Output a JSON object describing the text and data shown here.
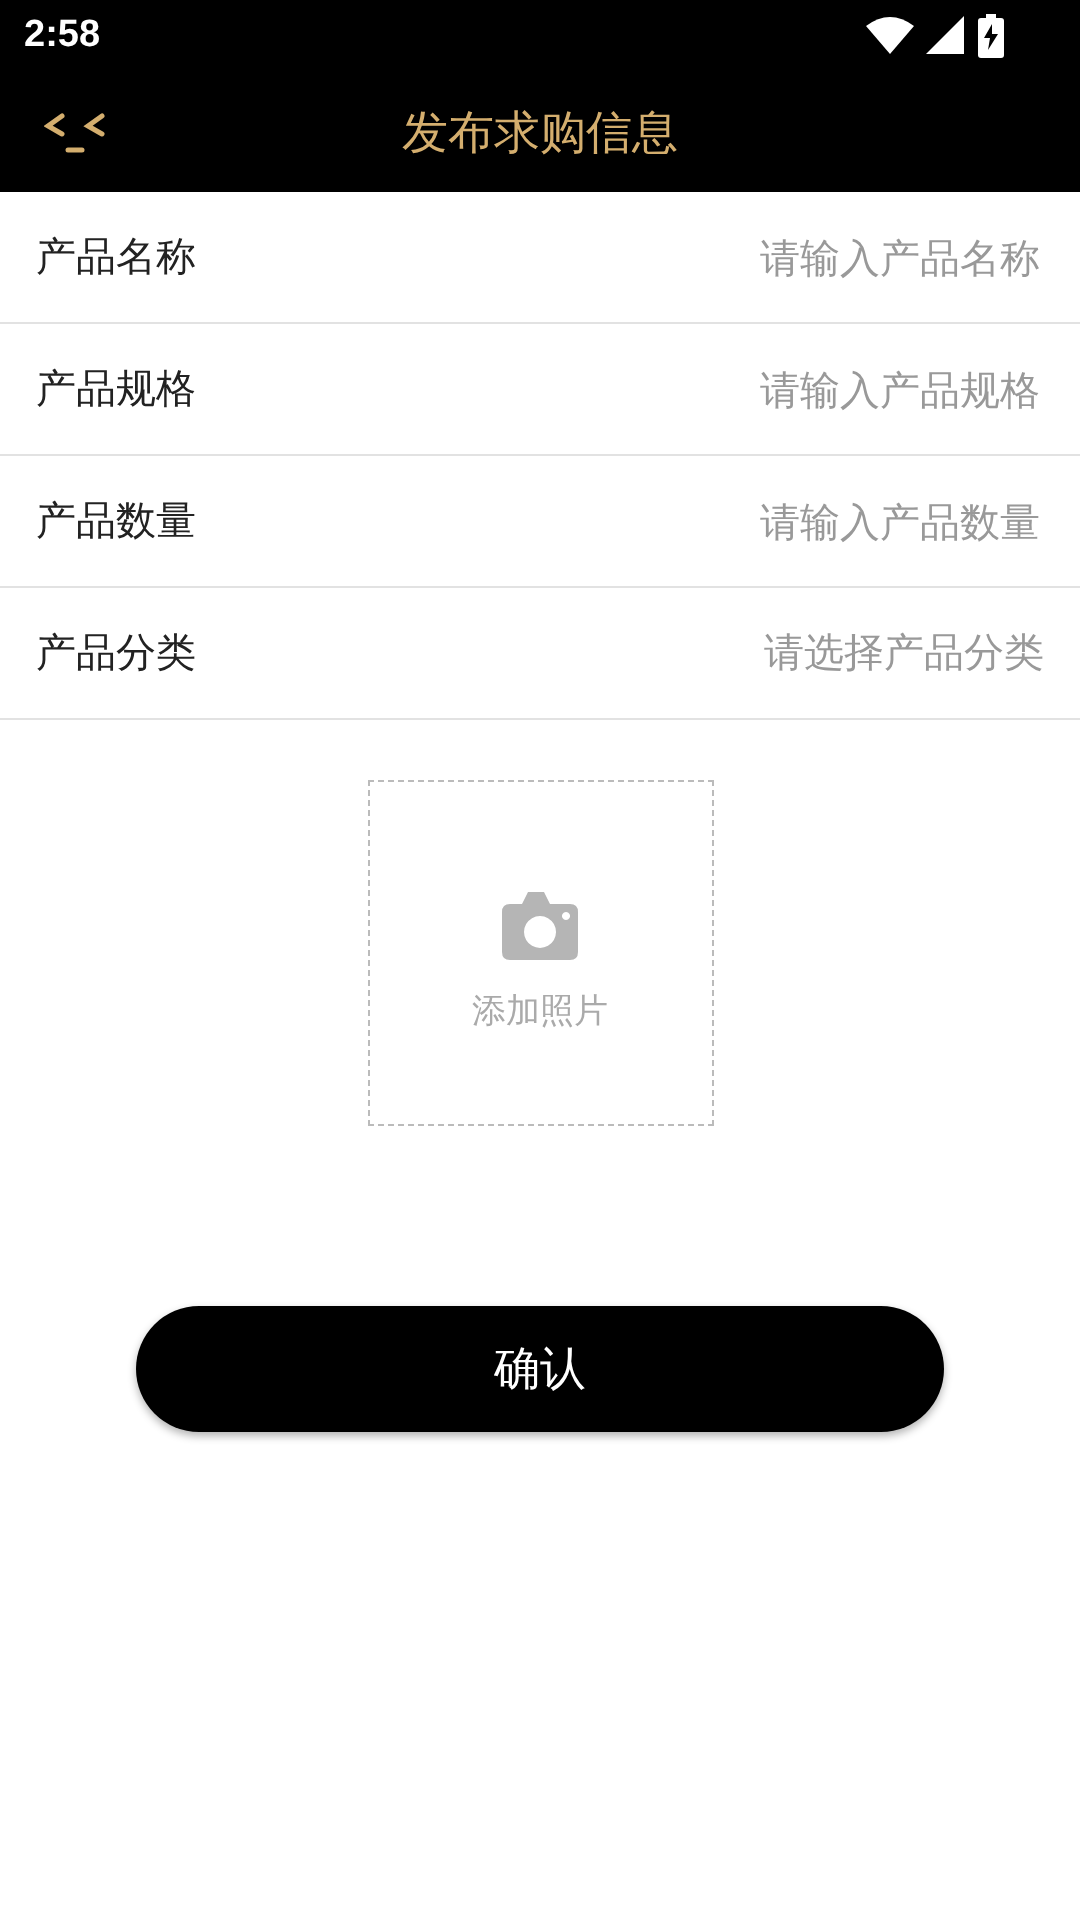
{
  "status_bar": {
    "time": "2:58"
  },
  "toolbar": {
    "title": "发布求购信息"
  },
  "fields": [
    {
      "label": "产品名称",
      "placeholder": "请输入产品名称",
      "kind": "input"
    },
    {
      "label": "产品规格",
      "placeholder": "请输入产品规格",
      "kind": "input"
    },
    {
      "label": "产品数量",
      "placeholder": "请输入产品数量",
      "kind": "input"
    },
    {
      "label": "产品分类",
      "placeholder": "请选择产品分类",
      "kind": "select"
    }
  ],
  "photo": {
    "label": "添加照片"
  },
  "confirm_button": "确认"
}
